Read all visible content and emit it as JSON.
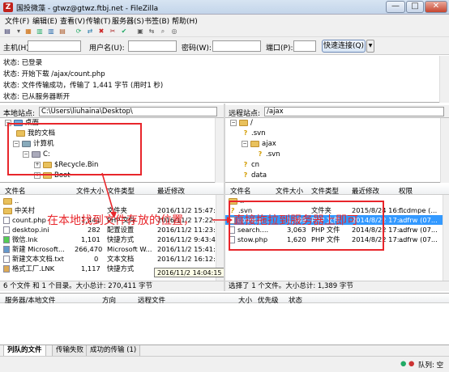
{
  "window": {
    "title": "国投微藻 - gtwz@gtwz.ftbj.net - FileZilla",
    "controls": [
      "—",
      "□",
      "✕"
    ]
  },
  "menu": [
    "文件(F)",
    "编辑(E)",
    "查看(V)",
    "传输(T)",
    "服务器(S)",
    "书签(B)",
    "帮助(H)"
  ],
  "quickconnect": {
    "host_label": "主机(H):",
    "user_label": "用户名(U):",
    "pass_label": "密码(W):",
    "port_label": "端口(P):",
    "connect_label": "快速连接(Q)",
    "host_value": "",
    "user_value": "",
    "pass_value": "",
    "port_value": ""
  },
  "log": [
    "状态: 已登录",
    "状态: 开始下载 /ajax/count.php",
    "状态: 文件传输成功，传输了 1,441 字节 (用时1 秒)",
    "状态: 已从服务器断开"
  ],
  "local": {
    "site_label": "本地站点:",
    "path": "C:\\Users\\liuhaina\\Desktop\\",
    "tree": [
      "桌面",
      "我的文档",
      "计算机",
      "C:",
      "$Recycle.Bin",
      "Boot"
    ],
    "columns": [
      "文件名",
      "文件大小",
      "文件类型",
      "最近修改"
    ],
    "rows": [
      {
        "name": "..",
        "size": "",
        "type": "",
        "date": ""
      },
      {
        "name": "中关村",
        "size": "",
        "type": "文件夹",
        "date": "2016/11/2 15:47:..."
      },
      {
        "name": "count.php",
        "size": "1,441",
        "type": "PHP 文件",
        "date": "2016/11/2 17:22:..."
      },
      {
        "name": "desktop.ini",
        "size": "282",
        "type": "配置设置",
        "date": "2016/11/2 11:23:..."
      },
      {
        "name": "微信.lnk",
        "size": "1,101",
        "type": "快捷方式",
        "date": "2016/11/2 9:43:44"
      },
      {
        "name": "新建 Microsoft...",
        "size": "266,470",
        "type": "Microsoft W...",
        "date": "2016/11/2 15:41:..."
      },
      {
        "name": "新建文本文档.txt",
        "size": "0",
        "type": "文本文档",
        "date": "2016/11/2 16:12:..."
      },
      {
        "name": "格式工厂.LNK",
        "size": "1,117",
        "type": "快捷方式",
        "date": "2016/11/2 14:04:15"
      }
    ],
    "tooltip": "2016/11/2 14:04:15",
    "status": "6 个文件 和 1 个目录。大小总计: 270,411 字节"
  },
  "remote": {
    "site_label": "远程站点:",
    "path": "/ajax",
    "tree": [
      "/",
      ".svn",
      "ajax",
      ".svn",
      "cn",
      "data"
    ],
    "columns": [
      "文件名",
      "文件大小",
      "文件类型",
      "最近修改",
      "权限"
    ],
    "rows": [
      {
        "name": "..",
        "size": "",
        "type": "",
        "date": "",
        "perm": ""
      },
      {
        "name": ".svn",
        "size": "",
        "type": "文件夹",
        "date": "2015/8/24 16:...",
        "perm": "flcdmpe (..."
      },
      {
        "name": "count.p...",
        "size": "1,389",
        "type": "PHP 文件",
        "date": "2014/8/22 17:...",
        "perm": "adfrw (07..."
      },
      {
        "name": "search....",
        "size": "3,063",
        "type": "PHP 文件",
        "date": "2014/8/22 17:...",
        "perm": "adfrw (07..."
      },
      {
        "name": "stow.php",
        "size": "1,620",
        "type": "PHP 文件",
        "date": "2014/8/22 17:...",
        "perm": "adfrw (07..."
      }
    ],
    "status": "选择了 1 个文件。大小总计: 1,389 字节"
  },
  "annotations": {
    "left": "在本地找到文件存放的位置，",
    "right": "直接拖拉到服务器上即可"
  },
  "queue": {
    "columns": [
      "服务器/本地文件",
      "方向",
      "远程文件",
      "大小",
      "优先级",
      "状态"
    ],
    "tabs": [
      "列队的文件",
      "传输失败",
      "成功的传输 (1)"
    ],
    "queue_label": "队列: 空"
  },
  "colors": {
    "annotation_red": "#e8262b",
    "selection_blue": "#3399ff"
  }
}
